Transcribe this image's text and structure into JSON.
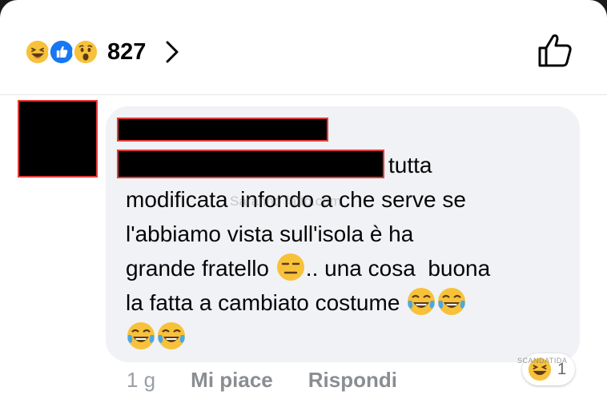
{
  "reactions": {
    "count": "827",
    "types": [
      "laugh-reaction",
      "like-reaction",
      "wow-reaction"
    ]
  },
  "comment": {
    "line1_tail": "tutta",
    "line2": "modificata  infondo a che serve se",
    "line3": "l'abbiamo vista sull'isola è ha",
    "line4_a": "grande fratello ",
    "line4_b": ".. una cosa  buona",
    "line5": "la fatta a cambiato costume ",
    "watermark": "Saranno fatto.com"
  },
  "meta": {
    "time": "1 g",
    "like_label": "Mi piace",
    "reply_label": "Rispondi"
  },
  "comment_reactions": {
    "count": "1",
    "watermark": "SCANDATIDA"
  },
  "colors": {
    "like_blue": "#1877f2",
    "emoji_yellow": "#f7b928",
    "redaction_border": "#e43b3b",
    "bubble_bg": "#f0f2f5"
  }
}
